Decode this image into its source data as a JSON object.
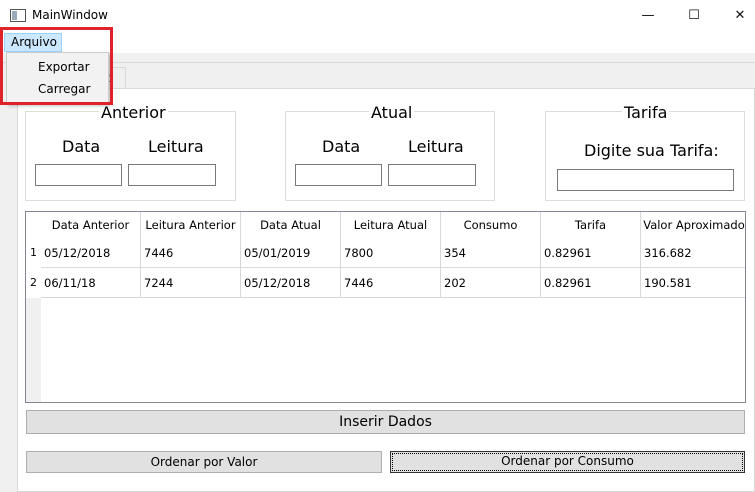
{
  "window": {
    "title": "MainWindow",
    "minimize": "—",
    "maximize": "☐",
    "close": "✕"
  },
  "menu": {
    "arquivo": "Arquivo",
    "items": [
      "Exportar",
      "Carregar"
    ]
  },
  "tabs": {
    "visible_tab": "2"
  },
  "groups": {
    "anterior": {
      "title": "Anterior",
      "data_label": "Data",
      "leitura_label": "Leitura",
      "data_value": "",
      "leitura_value": ""
    },
    "atual": {
      "title": "Atual",
      "data_label": "Data",
      "leitura_label": "Leitura",
      "data_value": "",
      "leitura_value": ""
    },
    "tarifa": {
      "title": "Tarifa",
      "prompt": "Digite sua Tarifa:",
      "value": ""
    }
  },
  "table": {
    "columns": [
      "Data Anterior",
      "Leitura Anterior",
      "Data Atual",
      "Leitura Atual",
      "Consumo",
      "Tarifa",
      "Valor Aproximado"
    ],
    "row_headers": [
      "1",
      "2"
    ],
    "rows": [
      [
        "05/12/2018",
        "7446",
        "05/01/2019",
        "7800",
        "354",
        "0.82961",
        "316.682"
      ],
      [
        "06/11/18",
        "7244",
        "05/12/2018",
        "7446",
        "202",
        "0.82961",
        "190.581"
      ]
    ]
  },
  "buttons": {
    "inserir": "Inserir Dados",
    "ordenar_valor": "Ordenar por Valor",
    "ordenar_consumo": "Ordenar por Consumo"
  },
  "colors": {
    "annotation_red": "#e0232b",
    "menu_highlight": "#cce8ff"
  }
}
